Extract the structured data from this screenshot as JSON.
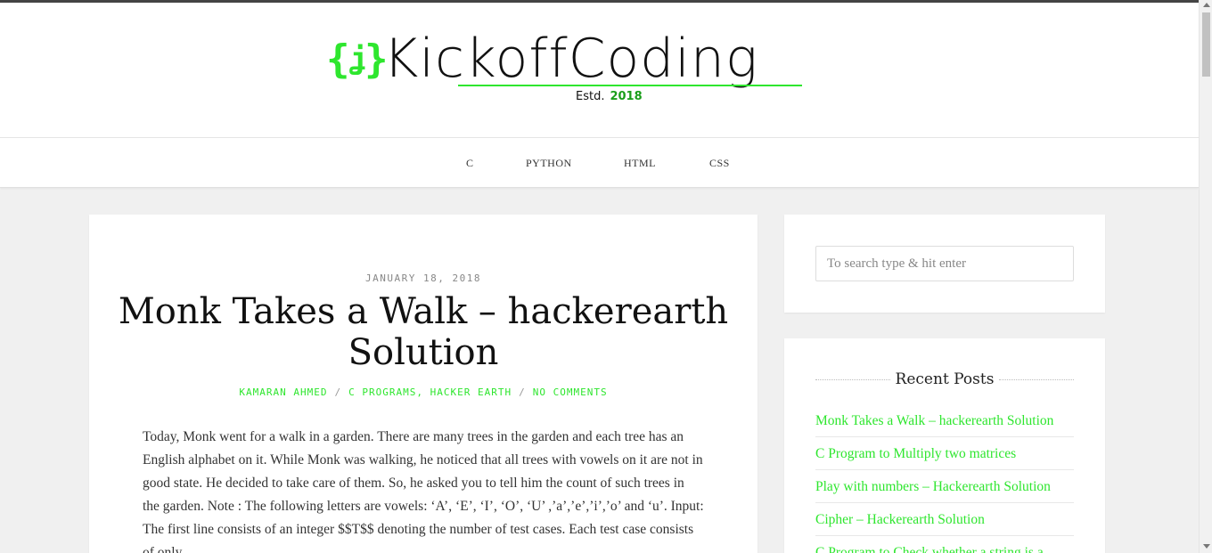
{
  "site": {
    "logo_braces": "{ɨ}",
    "logo_text": "KickoffCoding",
    "estd_label": "Estd.",
    "estd_year": "2018"
  },
  "nav": {
    "items": [
      "C",
      "PYTHON",
      "HTML",
      "CSS"
    ]
  },
  "post": {
    "date": "JANUARY 18, 2018",
    "title": "Monk Takes a Walk – hackerearth Solution",
    "author": "KAMARAN AHMED",
    "categories": "C PROGRAMS, HACKER EARTH",
    "comments": "NO COMMENTS",
    "body": "Today, Monk went for a walk in a garden. There are many trees in the garden and each tree has an English alphabet on it. While Monk was walking, he noticed that all trees with vowels on it are not in good state. He decided to take care of them. So, he asked you to tell him the count of such trees in the garden. Note : The following letters are vowels: ‘A’, ‘E’, ‘I’, ‘O’, ‘U’ ,’a’,’e’,’i’,’o’ and ‘u’. Input: The first line consists of an integer $$T$$ denoting the number of test cases. Each test case consists of only"
  },
  "sidebar": {
    "search_placeholder": "To search type & hit enter",
    "recent_title": "Recent Posts",
    "recent_posts": [
      "Monk Takes a Walk – hackerearth Solution",
      "C Program to Multiply two matrices",
      "Play with numbers – Hackerearth Solution",
      "Cipher – Hackerearth Solution",
      "C Program to Check whether a string is a"
    ]
  },
  "colors": {
    "accent": "#2ee62e",
    "year": "#1a9e1a"
  }
}
